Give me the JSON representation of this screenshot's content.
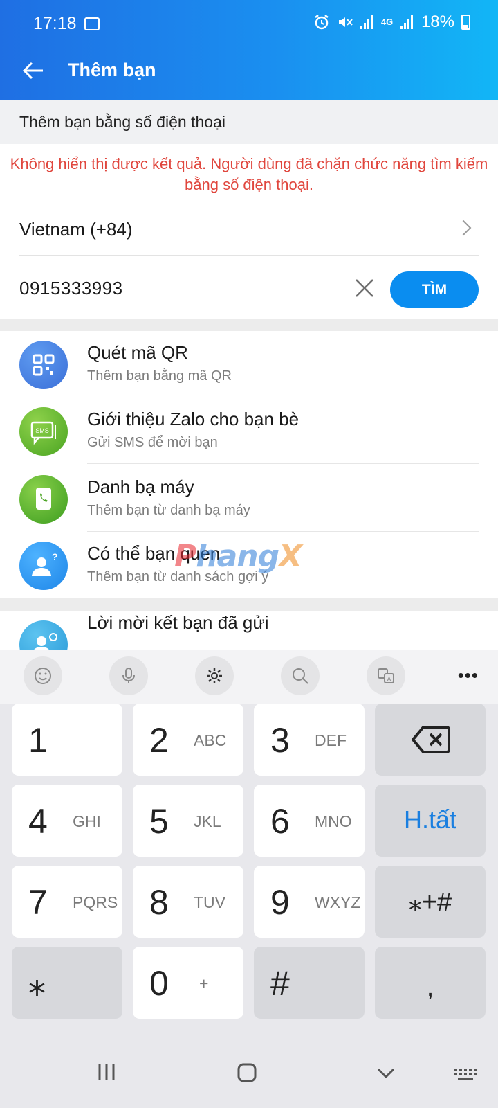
{
  "status_bar": {
    "time": "17:18",
    "network": "4G",
    "battery": "18%"
  },
  "header": {
    "title": "Thêm bạn"
  },
  "section_label": "Thêm bạn bằng số điện thoại",
  "error_message": "Không hiển thị được kết quả. Người dùng đã chặn chức năng tìm kiếm bằng số điện thoại.",
  "country": "Vietnam (+84)",
  "phone_input": {
    "value": "0915333993"
  },
  "find_button": "TÌM",
  "options": [
    {
      "title": "Quét mã QR",
      "subtitle": "Thêm bạn bằng mã QR",
      "icon": "qr-code-icon"
    },
    {
      "title": "Giới thiệu Zalo cho bạn bè",
      "subtitle": "Gửi SMS để mời bạn",
      "icon": "sms-icon"
    },
    {
      "title": "Danh bạ máy",
      "subtitle": "Thêm bạn từ danh bạ máy",
      "icon": "phone-contacts-icon"
    },
    {
      "title": "Có thể bạn quen",
      "subtitle": "Thêm bạn từ danh sách gợi ý",
      "icon": "suggested-friends-icon"
    }
  ],
  "sent_requests": {
    "title": "Lời mời kết bạn đã gửi",
    "icon": "sent-requests-icon"
  },
  "watermark": "Phongvu logo",
  "sms_badge": "SMS",
  "keyboard": {
    "rows": [
      [
        {
          "n": "1",
          "l": ""
        },
        {
          "n": "2",
          "l": "ABC"
        },
        {
          "n": "3",
          "l": "DEF"
        }
      ],
      [
        {
          "n": "4",
          "l": "GHI"
        },
        {
          "n": "5",
          "l": "JKL"
        },
        {
          "n": "6",
          "l": "MNO"
        }
      ],
      [
        {
          "n": "7",
          "l": "PQRS"
        },
        {
          "n": "8",
          "l": "TUV"
        },
        {
          "n": "9",
          "l": "WXYZ"
        }
      ]
    ],
    "done": "H.tất",
    "symbols": "⁎+#",
    "star": "⁎",
    "zero": "0",
    "zero_sub": "+",
    "hash": "#",
    "comma": ","
  }
}
